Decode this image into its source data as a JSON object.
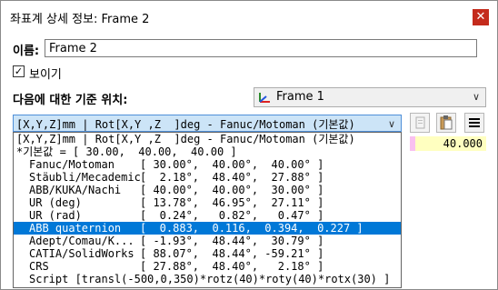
{
  "window": {
    "title": "좌표계 상세 정보: Frame 2",
    "close_glyph": "✕"
  },
  "name_label": "이름:",
  "name_value": "Frame 2",
  "visible_label": "보이기",
  "visible_checked": true,
  "reference_label": "다음에 대한 기준 위치:",
  "reference_value": "Frame 1",
  "format_selected": "[X,Y,Z]mm | Rot[X,Y ,Z  ]deg - Fanuc/Motoman (기본값)",
  "value_cell": "40.000",
  "list": {
    "header": "[X,Y,Z]mm | Rot[X,Y ,Z  ]deg - Fanuc/Motoman (기본값)",
    "default_row": "*기본값 = [ 30.00,  40.00,  40.00 ]",
    "rows": [
      {
        "name": "Fanuc/Motoman",
        "value": "[ 30.00°,  40.00°,  40.00° ]"
      },
      {
        "name": "Stäubli/Mecademic",
        "value": "[  2.18°,  48.40°,  27.88° ]"
      },
      {
        "name": "ABB/KUKA/Nachi",
        "value": "[ 40.00°,  40.00°,  30.00° ]"
      },
      {
        "name": "UR (deg)",
        "value": "[ 13.78°,  46.95°,  27.11° ]"
      },
      {
        "name": "UR (rad)",
        "value": "[  0.24°,   0.82°,   0.47° ]"
      },
      {
        "name": "ABB quaternion",
        "value": "[  0.883,  0.116,  0.394,  0.227 ]"
      },
      {
        "name": "Adept/Comau/K...",
        "value": "[ -1.93°,  48.44°,  30.79° ]"
      },
      {
        "name": "CATIA/SolidWorks",
        "value": "[ 88.07°,  48.44°, -59.21° ]"
      },
      {
        "name": "CRS",
        "value": "[ 27.88°,  48.40°,   2.18° ]"
      }
    ],
    "script_row": "Script [transl(-500,0,350)*rotz(40)*roty(40)*rotx(30) ]",
    "selected_row_name": "ABB quaternion"
  },
  "toolbar_icons": [
    "copy-icon",
    "paste-icon",
    "menu-icon"
  ]
}
